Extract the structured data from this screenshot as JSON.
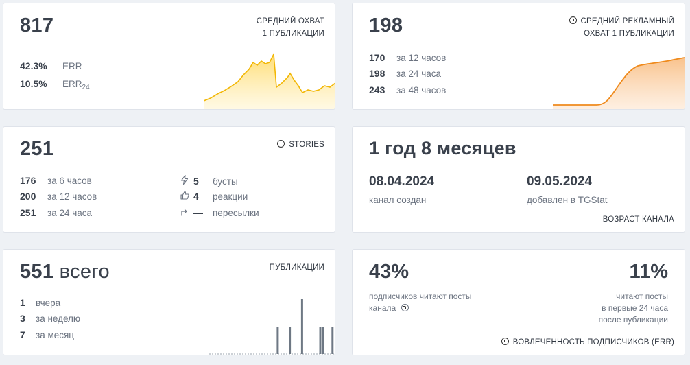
{
  "reach": {
    "value": "817",
    "caption_line1": "СРЕДНИЙ ОХВАТ",
    "caption_line2": "1 ПУБЛИКАЦИИ",
    "err_value": "42.3%",
    "err_label": "ERR",
    "err24_value": "10.5%",
    "err24_label": "ERR",
    "err24_sub": "24",
    "accent": "#f5c518"
  },
  "ad_reach": {
    "value": "198",
    "caption_line1": "СРЕДНИЙ РЕКЛАМНЫЙ",
    "caption_line2": "ОХВАТ 1 ПУБЛИКАЦИИ",
    "rows": [
      {
        "value": "170",
        "label": "за 12 часов"
      },
      {
        "value": "198",
        "label": "за 24 часа"
      },
      {
        "value": "243",
        "label": "за 48 часов"
      }
    ],
    "accent": "#ef8a1c"
  },
  "stories": {
    "value": "251",
    "caption": "STORIES",
    "rows": [
      {
        "value": "176",
        "label": "за 6 часов"
      },
      {
        "value": "200",
        "label": "за 12 часов"
      },
      {
        "value": "251",
        "label": "за 24 часа"
      }
    ],
    "stats": [
      {
        "icon": "lightning-icon",
        "value": "5",
        "label": "бусты"
      },
      {
        "icon": "thumbs-up-icon",
        "value": "4",
        "label": "реакции"
      },
      {
        "icon": "forward-arrow-icon",
        "value": "—",
        "label": "пересылки"
      }
    ]
  },
  "age": {
    "value": "1 год 8 месяцев",
    "created_date": "08.04.2024",
    "created_label": "канал создан",
    "added_date": "09.05.2024",
    "added_label": "добавлен в TGStat",
    "caption": "ВОЗРАСТ КАНАЛА"
  },
  "posts": {
    "value": "551",
    "value_suffix": "всего",
    "caption": "ПУБЛИКАЦИИ",
    "rows": [
      {
        "value": "1",
        "label": "вчера"
      },
      {
        "value": "3",
        "label": "за неделю"
      },
      {
        "value": "7",
        "label": "за месяц"
      }
    ],
    "daily_counts": [
      0,
      0,
      0,
      0,
      0,
      0,
      0,
      0,
      0,
      0,
      0,
      0,
      0,
      0,
      0,
      0,
      0,
      0,
      0,
      0,
      0,
      0,
      1,
      0,
      0,
      0,
      1,
      0,
      0,
      0,
      2,
      0,
      0,
      0,
      0,
      0,
      1,
      1,
      0,
      0,
      1
    ],
    "accent": "#6e7884"
  },
  "engagement": {
    "left_pct": "43%",
    "left_desc_line1": "подписчиков читают посты",
    "left_desc_line2": "канала",
    "right_pct": "11%",
    "right_desc_line1": "читают посты",
    "right_desc_line2": "в первые 24 часа",
    "right_desc_line3": "после публикации",
    "caption": "ВОВЛЕЧЕННОСТЬ ПОДПИСЧИКОВ (ERR)"
  }
}
